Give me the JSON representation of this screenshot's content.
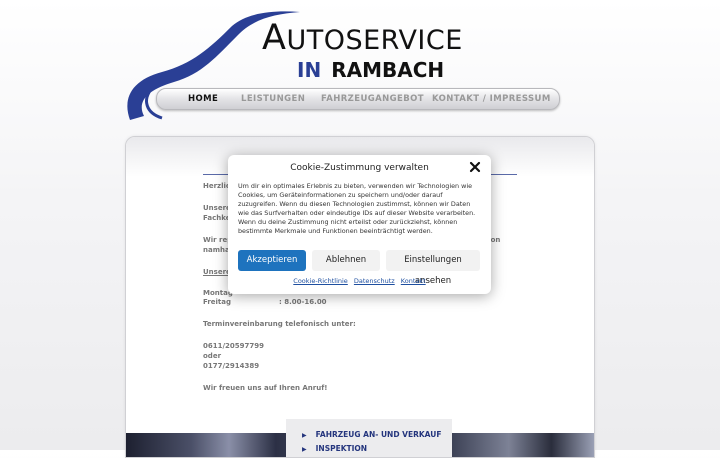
{
  "logo": {
    "line1_initial": "A",
    "line1_rest": "UTOSERVICE",
    "line2_prefix": "IN",
    "line2_main": "RAMBACH"
  },
  "nav": {
    "items": [
      {
        "label": "HOME",
        "active": true
      },
      {
        "label": "LEISTUNGEN",
        "active": false
      },
      {
        "label": "FAHRZEUGANGEBOT",
        "active": false
      },
      {
        "label": "KONTAKT / IMPRESSUM",
        "active": false
      }
    ]
  },
  "content": {
    "greeting": "Herzlich",
    "unsere1": "Unsere",
    "fachker": "Fachker",
    "wir_rep": "Wir repa",
    "namhaf": "namhaf",
    "von": "von",
    "unsere_u": "Unsere",
    "montag": "Montag",
    "freitag": "Freitag",
    "freitag_hours": ": 8.00-16.00",
    "terminvereinbarung": "Terminvereinbarung telefonisch unter:",
    "phone1": "0611/20597799",
    "oder": "oder",
    "phone2": "0177/2914389",
    "closing": "Wir freuen uns auf Ihren Anruf!"
  },
  "sidebar": {
    "items": [
      "FAHRZEUG AN- UND VERKAUF",
      "INSPEKTION"
    ]
  },
  "cookie": {
    "title": "Cookie-Zustimmung verwalten",
    "body": "Um dir ein optimales Erlebnis zu bieten, verwenden wir Technologien wie Cookies, um Geräteinformationen zu speichern und/oder darauf zuzugreifen. Wenn du diesen Technologien zustimmst, können wir Daten wie das Surfverhalten oder eindeutige IDs auf dieser Website verarbeiten. Wenn du deine Zustimmung nicht erteilst oder zurückziehst, können bestimmte Merkmale und Funktionen beeinträchtigt werden.",
    "accept": "Akzeptieren",
    "deny": "Ablehnen",
    "preferences": "Einstellungen ansehen",
    "links": [
      "Cookie-Richtlinie",
      "Datenschutz",
      "Kontakt"
    ],
    "accent_color": "#1e73be"
  },
  "colors": {
    "brand_blue": "#2a3f95",
    "nav_active": "#111111",
    "nav_inactive": "#999999"
  }
}
